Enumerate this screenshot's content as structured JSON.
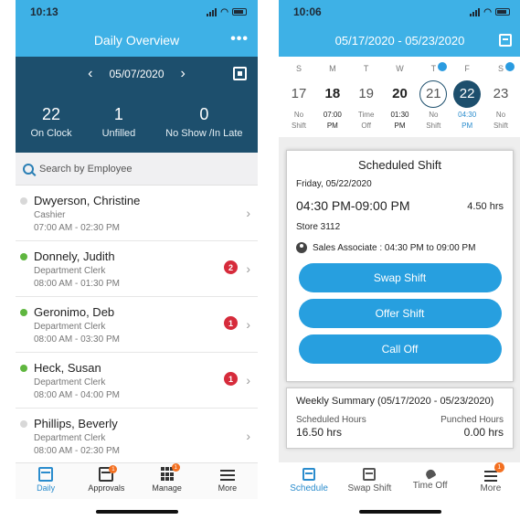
{
  "left": {
    "status_time": "10:13",
    "title": "Daily Overview",
    "more_menu": "•••",
    "date": "05/07/2020",
    "prev": "‹",
    "next": "›",
    "stats": [
      {
        "value": "22",
        "label": "On Clock"
      },
      {
        "value": "1",
        "label": "Unfilled"
      },
      {
        "value": "0",
        "label": "No Show /In Late"
      }
    ],
    "search_placeholder": "Search by Employee",
    "employees": [
      {
        "name": "Dwyerson, Christine",
        "role": "Cashier",
        "time": "07:00 AM - 02:30 PM",
        "status_color": "#d8d8d8",
        "badge": ""
      },
      {
        "name": "Donnely, Judith",
        "role": "Department Clerk",
        "time": "08:00 AM - 01:30 PM",
        "status_color": "#5fb63f",
        "badge": "2"
      },
      {
        "name": "Geronimo, Deb",
        "role": "Department Clerk",
        "time": "08:00 AM - 03:30 PM",
        "status_color": "#5fb63f",
        "badge": "1"
      },
      {
        "name": "Heck, Susan",
        "role": "Department Clerk",
        "time": "08:00 AM - 04:00 PM",
        "status_color": "#5fb63f",
        "badge": "1"
      },
      {
        "name": "Phillips, Beverly",
        "role": "Department Clerk",
        "time": "08:00 AM - 02:30 PM",
        "status_color": "#d8d8d8",
        "badge": ""
      }
    ],
    "chevron": "›",
    "tabs": [
      {
        "label": "Daily",
        "icon": "calendar-icon",
        "active": true
      },
      {
        "label": "Approvals",
        "icon": "checklist-icon",
        "badge": "1"
      },
      {
        "label": "Manage",
        "icon": "grid-icon",
        "badge": "1"
      },
      {
        "label": "More",
        "icon": "menu-icon"
      }
    ]
  },
  "right": {
    "status_time": "10:06",
    "date_range": "05/17/2020 - 05/23/2020",
    "week": [
      {
        "dow": "S",
        "num": "17",
        "sub1": "No",
        "sub2": "Shift"
      },
      {
        "dow": "M",
        "num": "18",
        "sub1": "07:00",
        "sub2": "PM",
        "bold": true
      },
      {
        "dow": "T",
        "num": "19",
        "sub1": "Time",
        "sub2": "Off"
      },
      {
        "dow": "W",
        "num": "20",
        "sub1": "01:30",
        "sub2": "PM",
        "bold": true
      },
      {
        "dow": "T",
        "num": "21",
        "sub1": "No",
        "sub2": "Shift",
        "ring": true,
        "dot": true
      },
      {
        "dow": "F",
        "num": "22",
        "sub1": "04:30",
        "sub2": "PM",
        "selected": true
      },
      {
        "dow": "S",
        "num": "23",
        "sub1": "No",
        "sub2": "Shift",
        "dot": true
      }
    ],
    "card": {
      "title": "Scheduled Shift",
      "date": "Friday, 05/22/2020",
      "time": "04:30 PM-09:00 PM",
      "hours": "4.50 hrs",
      "store": "Store 3112",
      "role": "Sales Associate : 04:30 PM to 09:00 PM",
      "buttons": [
        "Swap Shift",
        "Offer Shift",
        "Call Off"
      ]
    },
    "summary": {
      "title": "Weekly Summary (05/17/2020 - 05/23/2020)",
      "scheduled_label": "Scheduled Hours",
      "scheduled_value": "16.50 hrs",
      "punched_label": "Punched Hours",
      "punched_value": "0.00 hrs"
    },
    "tabs": [
      {
        "label": "Schedule",
        "icon": "calendar-icon",
        "active": true
      },
      {
        "label": "Swap Shift",
        "icon": "swap-calendar-icon"
      },
      {
        "label": "Time Off",
        "icon": "beach-umbrella-icon"
      },
      {
        "label": "More",
        "icon": "menu-icon",
        "badge": "1"
      }
    ]
  },
  "colors": {
    "header_blue": "#3eb1e6",
    "dark_navy": "#1d4f6d",
    "button_blue": "#279fdf",
    "badge_red": "#d62b3b",
    "badge_orange": "#f37021",
    "status_green": "#5fb63f"
  }
}
